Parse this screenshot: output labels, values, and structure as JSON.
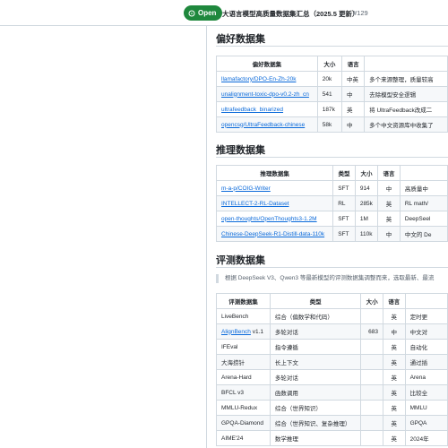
{
  "issue": {
    "state": "Open",
    "title": "大语言模型高质量数据集汇总（2025.5 更新）",
    "number": "#129"
  },
  "sections": {
    "preference": {
      "title": "偏好数据集",
      "headers": [
        "偏好数据集",
        "大小",
        "语言",
        ""
      ],
      "rows": [
        {
          "name": "llamafactory/DPO-En-Zh-20k",
          "size": "20k",
          "lang": "中英",
          "desc": "多个来源整理，质量较高"
        },
        {
          "name": "unalignment-toxic-dpo-v0.2-zh_cn",
          "size": "541",
          "lang": "中",
          "desc": "去除模型安全逻辑"
        },
        {
          "name": "ultrafeedback_binarized",
          "size": "187k",
          "lang": "英",
          "desc": "将 UltraFeedback改成二"
        },
        {
          "name": "opencsg/UltraFeedback-chinese",
          "size": "58k",
          "lang": "中",
          "desc": "多个中文资源库中收集了"
        }
      ]
    },
    "reasoning": {
      "title": "推理数据集",
      "headers": [
        "推理数据集",
        "类型",
        "大小",
        "语言",
        ""
      ],
      "rows": [
        {
          "name": "m-a-p/COIG-Writer",
          "type": "SFT",
          "size": "914",
          "lang": "中",
          "desc": "高质量中"
        },
        {
          "name": "INTELLECT-2-RL-Dataset",
          "type": "RL",
          "size": "285k",
          "lang": "英",
          "desc": "RL math/"
        },
        {
          "name": "open-thoughts/OpenThoughts3-1.2M",
          "type": "SFT",
          "size": "1M",
          "lang": "英",
          "desc": "DeepSeel"
        },
        {
          "name": "Chinese-DeepSeek-R1-Distill-data-110k",
          "type": "SFT",
          "size": "110k",
          "lang": "中",
          "desc": "中文的 De"
        }
      ]
    },
    "evaluation": {
      "title": "评测数据集",
      "note": "根据 DeepSeek V3、Qwen3 等最新模型的评测数据集调整而来，选取最新、最流",
      "headers": [
        "评测数据集",
        "类型",
        "大小",
        "语言",
        ""
      ],
      "rows": [
        {
          "name": "LiveBench",
          "link": false,
          "suffix": "",
          "type": "综合（偏数学和代码）",
          "size": "",
          "lang": "英",
          "desc": "定时更"
        },
        {
          "name": "AlignBench",
          "link": true,
          "suffix": " v1.1",
          "type": "多轮对话",
          "size": "683",
          "lang": "中",
          "desc": "中文对"
        },
        {
          "name": "IFEval",
          "link": false,
          "suffix": "",
          "type": "指令遵循",
          "size": "",
          "lang": "英",
          "desc": "自动化"
        },
        {
          "name": "大海捞针",
          "link": false,
          "suffix": "",
          "type": "长上下文",
          "size": "",
          "lang": "英",
          "desc": "通过插"
        },
        {
          "name": "Arena-Hard",
          "link": false,
          "suffix": "",
          "type": "多轮对话",
          "size": "",
          "lang": "英",
          "desc": "Arena"
        },
        {
          "name": "BFCL v3",
          "link": false,
          "suffix": "",
          "type": "函数调用",
          "size": "",
          "lang": "英",
          "desc": "比较全"
        },
        {
          "name": "MMLU-Redux",
          "link": false,
          "suffix": "",
          "type": "综合（世界知识）",
          "size": "",
          "lang": "英",
          "desc": "MMLU"
        },
        {
          "name": "GPQA-Diamond",
          "link": false,
          "suffix": "",
          "type": "综合（世界知识、复杂推理）",
          "size": "",
          "lang": "英",
          "desc": "GPQA"
        },
        {
          "name": "AIME'24",
          "link": false,
          "suffix": "",
          "type": "数学推理",
          "size": "",
          "lang": "英",
          "desc": "2024年"
        }
      ]
    }
  },
  "colors": {
    "link": "#0969da",
    "open_badge": "#1f883d",
    "border": "#d1d9e0",
    "stripe": "#f6f8fa"
  },
  "icons": {
    "state_icon": "issue-opened-icon"
  }
}
